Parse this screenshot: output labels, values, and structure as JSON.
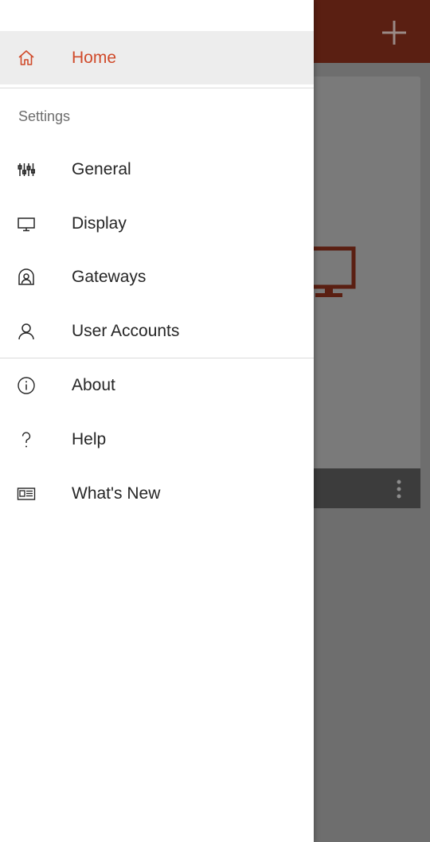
{
  "colors": {
    "accent": "#d04a2a",
    "text": "#262626",
    "muted": "#6d6d6d",
    "active_row_bg": "#ededed",
    "toolbar_dim": "#5a1f12",
    "overlay": "#6e6e6e"
  },
  "drawer": {
    "home": {
      "label": "Home",
      "icon": "home-icon"
    },
    "settings_header": "Settings",
    "settings_items": [
      {
        "label": "General",
        "icon": "sliders-icon"
      },
      {
        "label": "Display",
        "icon": "monitor-icon"
      },
      {
        "label": "Gateways",
        "icon": "gateway-icon"
      },
      {
        "label": "User Accounts",
        "icon": "user-icon"
      }
    ],
    "info_items": [
      {
        "label": "About",
        "icon": "info-icon"
      },
      {
        "label": "Help",
        "icon": "help-icon"
      },
      {
        "label": "What's New",
        "icon": "news-icon"
      }
    ]
  },
  "background": {
    "toolbar_action": "add-icon",
    "card_icon": "monitor-icon",
    "card_menu": "more-vertical-icon"
  }
}
